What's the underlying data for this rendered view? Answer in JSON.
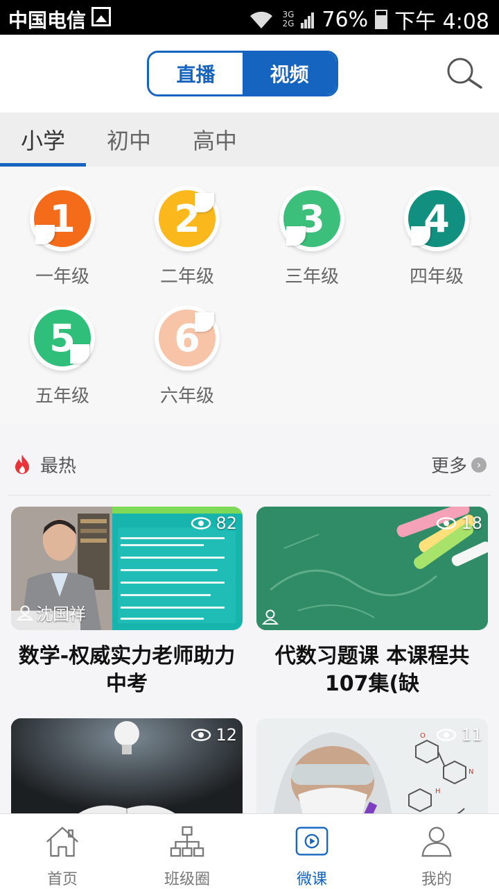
{
  "status_bar": {
    "carrier": "中国电信",
    "network": [
      "3G",
      "2G"
    ],
    "battery": "76%",
    "time": "下午 4:08"
  },
  "header": {
    "segment": [
      "直播",
      "视频"
    ],
    "active_segment": "视频"
  },
  "level_tabs": {
    "items": [
      "小学",
      "初中",
      "高中"
    ],
    "active": "小学"
  },
  "grades": [
    {
      "number": "1",
      "label": "一年级",
      "color": "#f46b1a"
    },
    {
      "number": "2",
      "label": "二年级",
      "color": "#fbb81c"
    },
    {
      "number": "3",
      "label": "三年级",
      "color": "#3cbf7a"
    },
    {
      "number": "4",
      "label": "四年级",
      "color": "#12907f"
    },
    {
      "number": "5",
      "label": "五年级",
      "color": "#2fbf7a"
    },
    {
      "number": "6",
      "label": "六年级",
      "color": "#f8c4a8"
    }
  ],
  "hot": {
    "title": "最热",
    "more": "更多"
  },
  "videos": [
    {
      "views": "82",
      "author": "沈国祥",
      "title": "数学-权威实力老师助力中考"
    },
    {
      "views": "18",
      "author": "",
      "title": "代数习题课 本课程共107集(缺"
    },
    {
      "views": "12",
      "author": "",
      "title": ""
    },
    {
      "views": "11",
      "author": "",
      "title": ""
    }
  ],
  "tabbar": {
    "items": [
      "首页",
      "班级圈",
      "微课",
      "我的"
    ],
    "active": "微课"
  },
  "colors": {
    "accent": "#1565c0"
  }
}
